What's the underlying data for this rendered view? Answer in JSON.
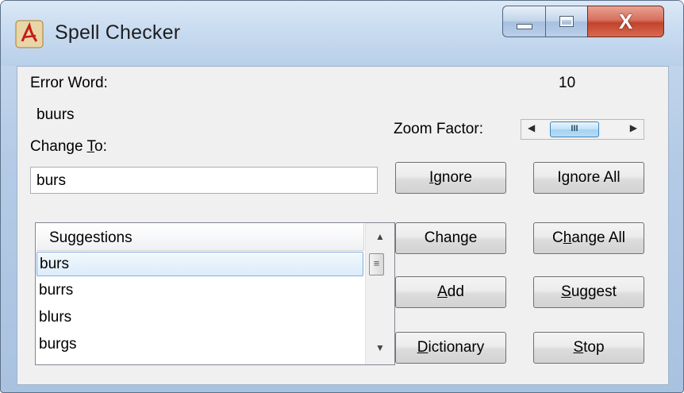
{
  "window": {
    "title": "Spell Checker",
    "close_glyph": "X"
  },
  "labels": {
    "error_word": "Error Word:",
    "error_word_value": "buurs",
    "change_to_prefix": "Change ",
    "change_to_u": "T",
    "change_to_suffix": "o:",
    "zoom_factor": "Zoom Factor:",
    "zoom_value": "10"
  },
  "change_to": {
    "value": "burs"
  },
  "zoom_slider": {
    "min": 0,
    "max": 20,
    "value": 10,
    "thumb_grip": "III"
  },
  "buttons": {
    "ignore": {
      "u": "I",
      "rest": "gnore"
    },
    "ignore_all": {
      "pre": "I",
      "u": "g",
      "rest": "nore All"
    },
    "change": {
      "label": "Change"
    },
    "change_all": {
      "pre": "C",
      "u": "h",
      "rest": "ange All"
    },
    "add": {
      "u": "A",
      "rest": "dd"
    },
    "suggest": {
      "u": "S",
      "rest": "uggest"
    },
    "dictionary": {
      "u": "D",
      "rest": "ictionary"
    },
    "stop": {
      "u": "S",
      "rest": "top"
    }
  },
  "suggestions": {
    "header": "Suggestions",
    "items": [
      "burs",
      "burrs",
      "blurs",
      "burgs"
    ],
    "selected_index": 0
  },
  "icons": {
    "app": "acrobat-logo-icon",
    "minimize": "minimize-icon",
    "maximize": "maximize-icon",
    "close": "close-icon"
  },
  "colors": {
    "title_bar": "#c7daef",
    "close_button": "#c2432c",
    "selection": "#dbecfa",
    "thumb": "#a6d2f2"
  }
}
